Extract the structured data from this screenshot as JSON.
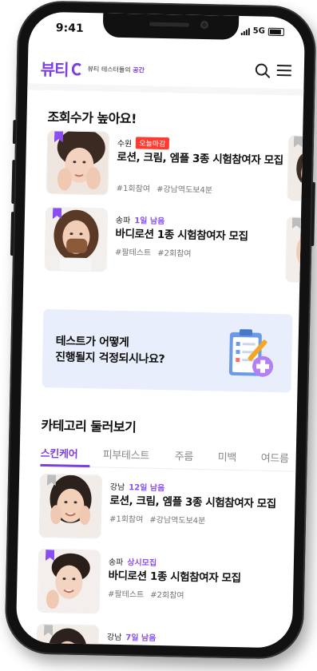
{
  "status": {
    "time": "9:41",
    "network": "5G"
  },
  "app": {
    "logo": "뷰티",
    "tagline_prefix": "뷰티 테스터들의 ",
    "tagline_highlight": "공간"
  },
  "popular": {
    "title": "조회수가 높아요!",
    "items": [
      {
        "region": "수원",
        "badge": "오늘마감",
        "title": "로션, 크림, 엠플 3종 시험참여자 모집",
        "tags": [
          "#1회참여",
          "#강남역도보4분"
        ]
      },
      {
        "region": "송파",
        "badge": "1일 남음",
        "title": "바디로션 1종 시험참여자 모집",
        "tags": [
          "#팔테스트",
          "#2회참여"
        ]
      }
    ]
  },
  "banner": {
    "line1": "테스트가 어떻게",
    "line2": "진행될지 걱정되시나요?"
  },
  "category": {
    "title": "카테고리 둘러보기",
    "tabs": [
      "스킨케어",
      "피부테스트",
      "주름",
      "미백",
      "여드름"
    ],
    "items": [
      {
        "region": "강남",
        "badge": "12일 남음",
        "title": "로션, 크림, 엠플 3종 시험참여자 모집",
        "tags": [
          "#1회참여",
          "#강남역도보4분"
        ]
      },
      {
        "region": "송파",
        "badge": "상시모집",
        "title": "바디로션 1종 시험참여자 모집",
        "tags": [
          "#팔테스트",
          "#2회참여"
        ]
      },
      {
        "region": "강남",
        "badge": "7일 남음"
      }
    ]
  },
  "colors": {
    "brand": "#7b3fe4",
    "deadline": "#ff3b30",
    "banner_bg": "#e8eefb"
  }
}
